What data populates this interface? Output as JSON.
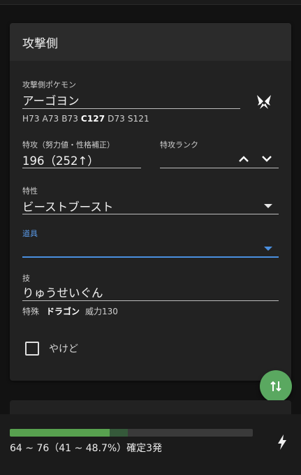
{
  "attacker": {
    "header_title": "攻撃側",
    "pokemon": {
      "label": "攻撃側ポケモン",
      "value": "アーゴヨン",
      "stats_prefix": "H73 A73 B73 ",
      "stats_highlight": "C127",
      "stats_suffix": " D73 S121"
    },
    "spatk": {
      "label": "特攻（努力値・性格補正）",
      "value": "196（252↑）"
    },
    "rank": {
      "label": "特攻ランク",
      "value": ""
    },
    "ability": {
      "label": "特性",
      "value": "ビーストブースト"
    },
    "item": {
      "label": "道具",
      "value": ""
    },
    "move": {
      "label": "技",
      "value": "りゅうせいぐん",
      "category": "特殊",
      "type": "ドラゴン",
      "power": "威力130"
    },
    "burn": {
      "label": "やけど",
      "checked": false
    }
  },
  "result": {
    "text": "64 ~ 76（41 ~ 48.7%）確定3発",
    "min_percent": 41,
    "max_percent": 48.7
  },
  "colors": {
    "accent": "#4a8fe0",
    "fab": "#5aa860",
    "bar_fill": "#58a14f",
    "bar_range": "#35593a"
  },
  "icons": {
    "pokemon": "pokemon-type-icon",
    "rank_up": "chevron-up-icon",
    "rank_down": "chevron-down-icon",
    "swap": "swap-vertical-icon",
    "flash": "flash-icon"
  }
}
